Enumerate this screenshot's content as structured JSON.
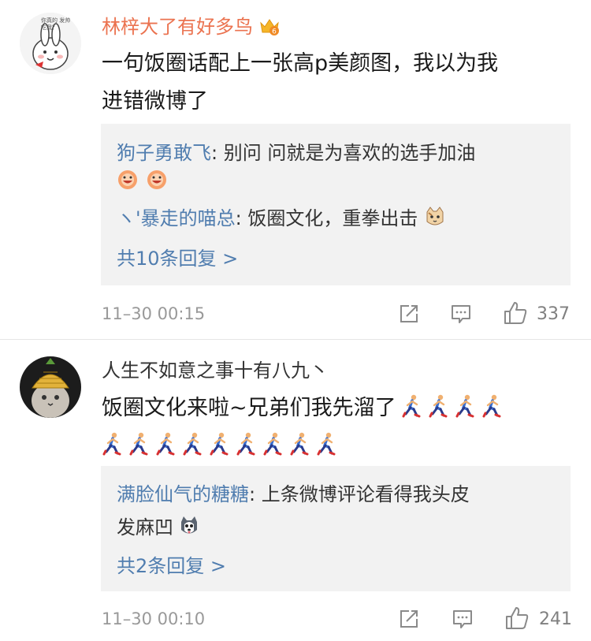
{
  "comments": [
    {
      "username": "林梓大了有好多鸟",
      "avatar_caption": "你真的 发帅吃我？",
      "vip_level": "6",
      "text_lines": [
        "一句饭圈话配上一张高p美颜图，我以为我",
        "进错微博了"
      ],
      "replies": [
        {
          "name": "狗子勇敢飞",
          "text": ": 别问 问就是为喜欢的选手加油"
        },
        {
          "name": "ヽ'暴走的喵总",
          "text": ": 饭圈文化，重拳出击"
        }
      ],
      "more_replies": "共10条回复 >",
      "timestamp": "11–30 00:15",
      "like_count": "337"
    },
    {
      "username": "人生不如意之事十有八九丶",
      "text_lines": [
        "饭圈文化来啦~兄弟们我先溜了"
      ],
      "runner_count": 13,
      "replies": [
        {
          "name": "满脸仙气的糖糖",
          "text": ": 上条微博评论看得我头皮",
          "continuation": "发麻凹"
        }
      ],
      "more_replies": "共2条回复 >",
      "timestamp": "11–30 00:10",
      "like_count": "241"
    }
  ],
  "icons": {
    "share": "share-icon",
    "comment": "comment-icon",
    "like": "thumbs-up-icon",
    "crown": "vip-crown-icon",
    "runner": "running-man-emoji",
    "face_grin": "grinning-face-emoji",
    "cat": "cat-face-emoji",
    "husky": "husky-face-emoji"
  },
  "colors": {
    "vip_name": "#eb7350",
    "link": "#507daf",
    "reply_bg": "#f2f2f2",
    "meta": "#999999"
  }
}
